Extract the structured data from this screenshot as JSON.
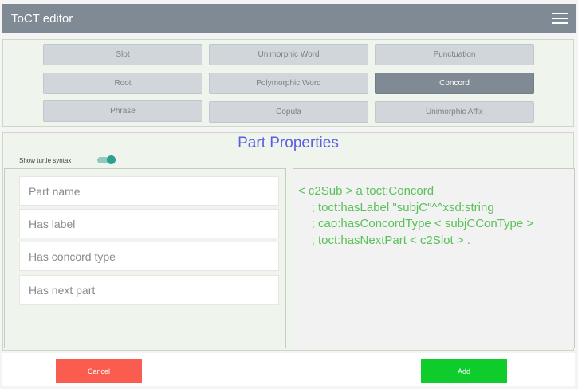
{
  "header": {
    "title": "ToCT editor",
    "menu_icon": "hamburger-menu-icon"
  },
  "part_types": {
    "buttons": [
      {
        "label": "Slot",
        "active": false
      },
      {
        "label": "Unimorphic Word",
        "active": false
      },
      {
        "label": "Punctuation",
        "active": false
      },
      {
        "label": "Root",
        "active": false
      },
      {
        "label": "Polymorphic Word",
        "active": false
      },
      {
        "label": "Concord",
        "active": true
      },
      {
        "label": "Phrase",
        "active": false
      },
      {
        "label": "Copula",
        "active": false
      },
      {
        "label": "Unimorphic Affix",
        "active": false
      }
    ]
  },
  "properties": {
    "title": "Part Properties",
    "toggle_label": "Show turtle syntax",
    "toggle_on": true,
    "fields": {
      "part_name": {
        "placeholder": "Part name",
        "value": ""
      },
      "has_label": {
        "placeholder": "Has label",
        "value": ""
      },
      "has_concord_type": {
        "placeholder": "Has concord type",
        "value": ""
      },
      "has_next_part": {
        "placeholder": "Has next part",
        "value": ""
      }
    },
    "turtle_syntax": [
      "< c2Sub > a toct:Concord",
      "    ; toct:hasLabel \"subjC\"^^xsd:string",
      "    ; cao:hasConcordType < subjCConType >",
      "    ; toct:hasNextPart < c2Slot > ."
    ]
  },
  "footer": {
    "cancel_label": "Cancel",
    "add_label": "Add"
  },
  "colors": {
    "header": "#7f8a94",
    "panel_bg": "#eff4ec",
    "title_accent": "#5a5fe0",
    "syntax_text": "#59c159",
    "cancel": "#fa5c50",
    "add": "#0fcc2d",
    "toggle": "#2e9e8f"
  }
}
